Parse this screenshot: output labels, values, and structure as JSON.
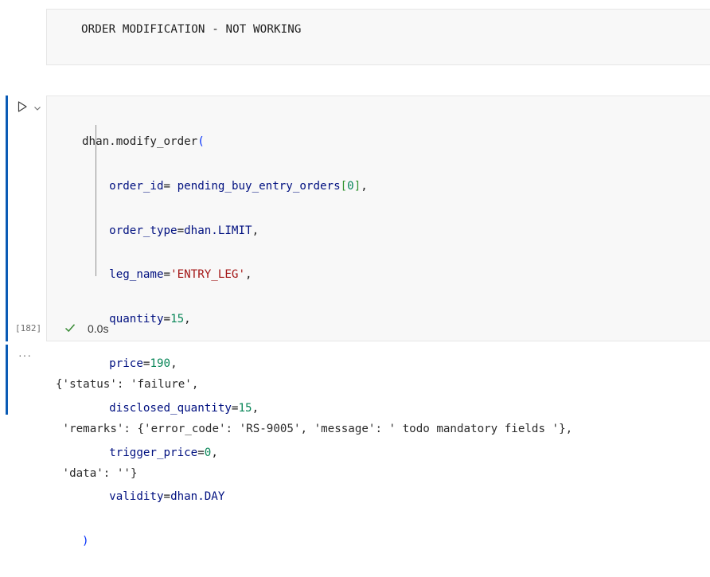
{
  "markdown_cell": {
    "text": "ORDER MODIFICATION - NOT WORKING"
  },
  "code_cell": {
    "execution_count": "[182]",
    "status_icon": "check-icon",
    "duration": "0.0s",
    "run_icon": "play-icon",
    "run_menu_icon": "chevron-down-icon",
    "code": {
      "l1_fn": "dhan.modify_order",
      "l1_paren": "(",
      "l2_var": "order_id",
      "l2_eq": "= ",
      "l2_obj": "pending_buy_entry_orders",
      "l2_ob": "[",
      "l2_idx": "0",
      "l2_cb": "]",
      "l2_end": ",",
      "l3_var": "order_type",
      "l3_eq": "=",
      "l3_val": "dhan.LIMIT",
      "l3_end": ",",
      "l4_var": "leg_name",
      "l4_eq": "=",
      "l4_val": "'ENTRY_LEG'",
      "l4_end": ",",
      "l5_var": "quantity",
      "l5_eq": "=",
      "l5_val": "15",
      "l5_end": ",",
      "l6_var": "price",
      "l6_eq": "=",
      "l6_val": "190",
      "l6_end": ",",
      "l7_var": "disclosed_quantity",
      "l7_eq": "=",
      "l7_val": "15",
      "l7_end": ",",
      "l8_var": "trigger_price",
      "l8_eq": "=",
      "l8_val": "0",
      "l8_end": ",",
      "l9_var": "validity",
      "l9_eq": "=",
      "l9_val": "dhan.DAY",
      "l10_paren": ")"
    }
  },
  "output": {
    "menu_label": "···",
    "lines": [
      "{'status': 'failure',",
      " 'remarks': {'error_code': 'RS-9005', 'message': ' todo mandatory fields '},",
      " 'data': ''}"
    ]
  },
  "colors": {
    "accent_bar": "#0a5bb5",
    "cell_bg": "#f8f8f8",
    "string": "#a31515",
    "number": "#098658",
    "variable": "#001080",
    "paren": "#0431fa",
    "success": "#388a34"
  }
}
